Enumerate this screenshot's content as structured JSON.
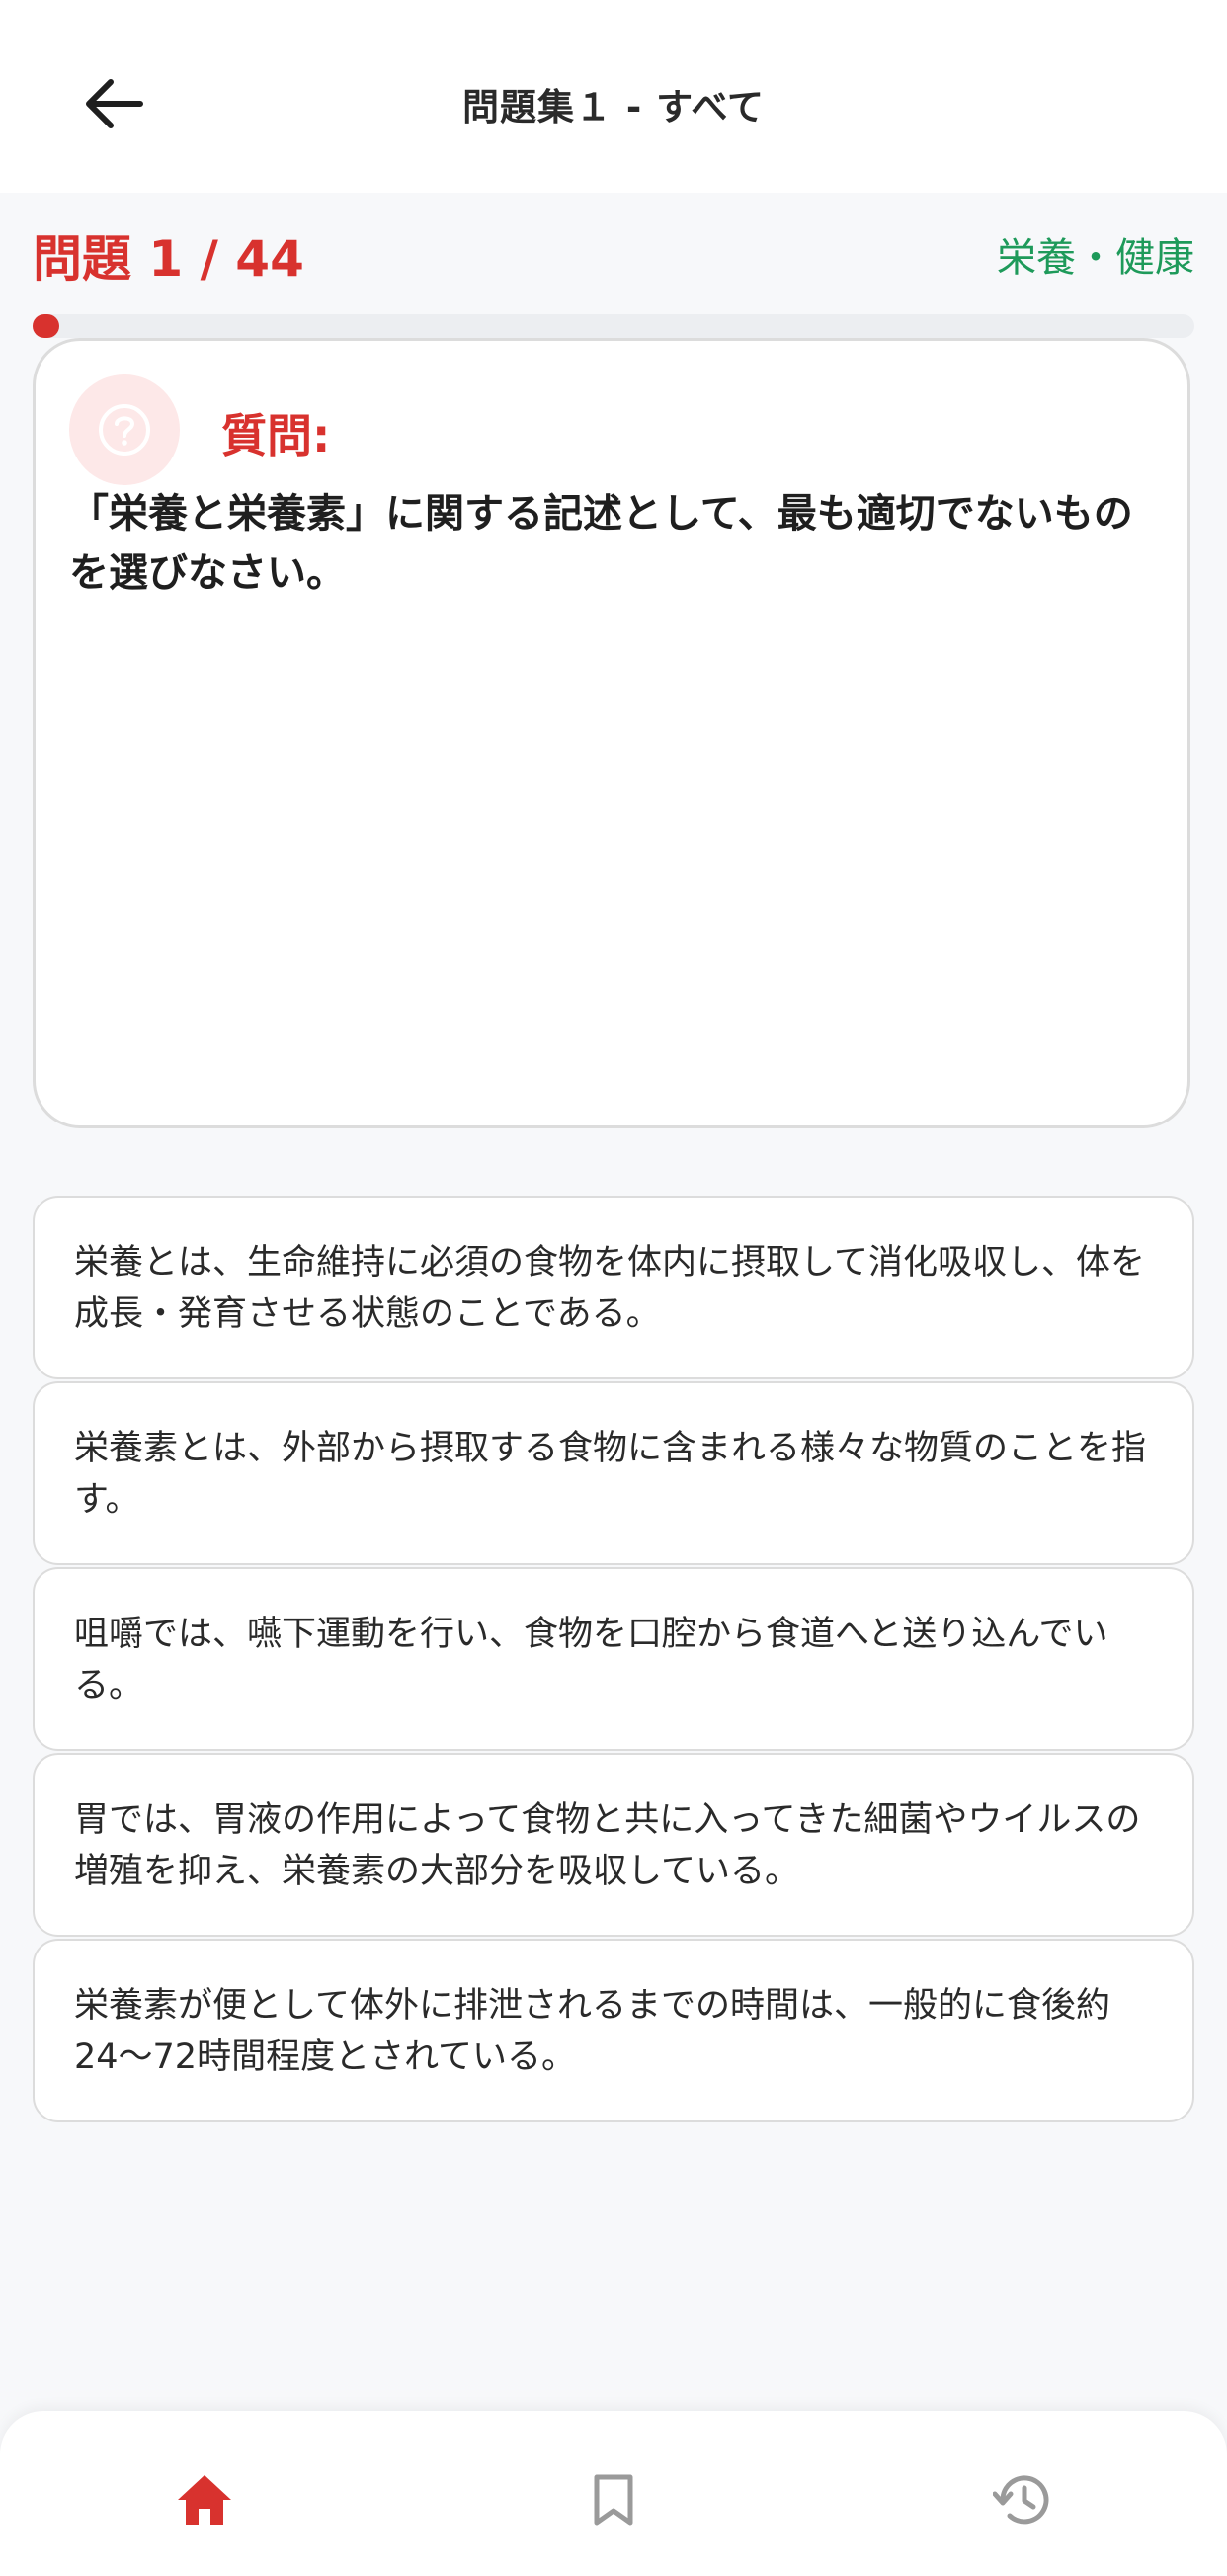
{
  "header": {
    "title": "問題集１ - すべて",
    "back_icon": "arrow-left-icon"
  },
  "progress": {
    "label": "問題 1 / 44",
    "current": 1,
    "total": 44,
    "category": "栄養・健康"
  },
  "question": {
    "icon": "question-circle-icon",
    "heading": "質問:",
    "text": "「栄養と栄養素」に関する記述として、最も適切でないものを選びなさい。"
  },
  "options": [
    {
      "text": "栄養とは、生命維持に必須の食物を体内に摂取して消化吸収し、体を成長・発育させる状態のことである。"
    },
    {
      "text": "栄養素とは、外部から摂取する食物に含まれる様々な物質のことを指す。"
    },
    {
      "text": "咀嚼では、嚥下運動を行い、食物を口腔から食道へと送り込んでいる。"
    },
    {
      "text": "胃では、胃液の作用によって食物と共に入ってきた細菌やウイルスの増殖を抑え、栄養素の大部分を吸収している。"
    },
    {
      "text": "栄養素が便として体外に排泄されるまでの時間は、一般的に食後約24〜72時間程度とされている。"
    }
  ],
  "bottom_nav": {
    "items": [
      {
        "icon": "home-icon",
        "active": true
      },
      {
        "icon": "bookmark-icon",
        "active": false
      },
      {
        "icon": "history-icon",
        "active": false
      }
    ]
  },
  "colors": {
    "accent": "#d8322e",
    "category": "#1e9a5a",
    "inactive_icon": "#9a9a9a"
  }
}
